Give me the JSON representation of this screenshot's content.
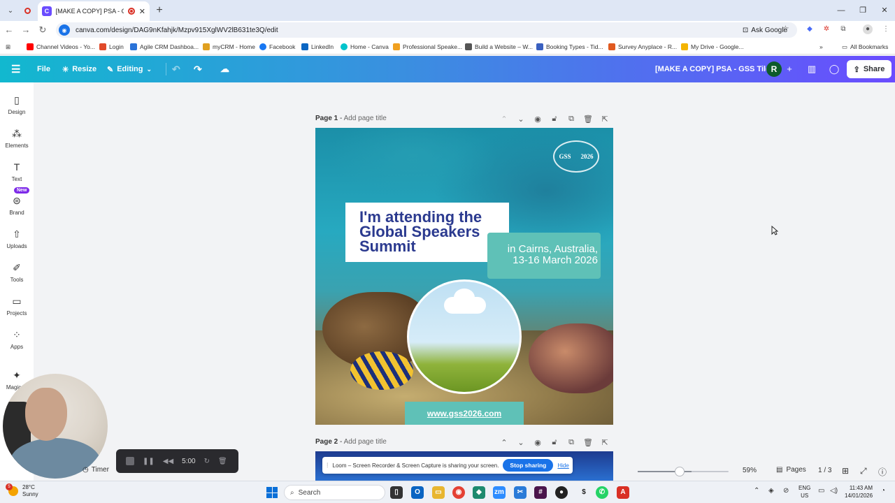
{
  "browser": {
    "tab_title": "[MAKE A COPY] PSA - GSS",
    "new_tab": "+",
    "url": "canva.com/design/DAG9nKfahjk/Mzpv915XglWV2lB631te3Q/edit",
    "ask_google": "Ask Google",
    "bookmarks": [
      "Channel Videos - Yo...",
      "Login",
      "Agile CRM Dashboa...",
      "myCRM - Home",
      "Facebook",
      "LinkedIn",
      "Home - Canva",
      "Professional Speake...",
      "Build a Website – W...",
      "Booking Types - Tid...",
      "Survey Anyplace - R...",
      "My Drive - Google..."
    ],
    "all_bookmarks": "All Bookmarks",
    "bookmark_colors": [
      "#ff0000",
      "#e04a2a",
      "#2a73d8",
      "#e0a020",
      "#1877f2",
      "#0a66c2",
      "#00c4cc",
      "#f0a020",
      "#555555",
      "#3a60c0",
      "#e05a20",
      "#f4b400"
    ]
  },
  "canva_header": {
    "file": "File",
    "resize": "Resize",
    "editing": "Editing",
    "doc_title": "[MAKE A COPY] PSA - GSS Tiles",
    "avatar_initial": "R",
    "share": "Share"
  },
  "sidebar": {
    "items": [
      "Design",
      "Elements",
      "Text",
      "Brand",
      "Uploads",
      "Tools",
      "Projects",
      "Apps",
      "Magic M"
    ],
    "new_badge": "New"
  },
  "pages": [
    {
      "label": "Page 1",
      "title_placeholder": "Add page title"
    },
    {
      "label": "Page 2",
      "title_placeholder": "Add page title"
    }
  ],
  "design": {
    "logo_left": "GSS",
    "logo_right": "2026",
    "headline": [
      "I'm attending the",
      "Global Speakers",
      "Summit"
    ],
    "location": [
      "in Cairns, Australia,",
      "13-16 March 2026"
    ],
    "website": "www.gss2026.com",
    "colors": {
      "headline": "#2b3a8f",
      "teal_box": "#5fc1b7"
    }
  },
  "loom": {
    "message": "Loom – Screen Recorder & Screen Capture is sharing your screen.",
    "stop": "Stop sharing",
    "hide": "Hide"
  },
  "bottom_bar": {
    "zoom": "59%",
    "zoom_level": 0.59,
    "pages": "Pages",
    "page_count": "1 / 3"
  },
  "timer": {
    "label": "Timer",
    "time": "5:00"
  },
  "taskbar": {
    "temperature": "28°C",
    "weather": "Sunny",
    "weather_badge": "5",
    "search": "Search",
    "lang_top": "ENG",
    "lang_bottom": "US",
    "time": "11:43 AM",
    "date": "14/01/2026"
  }
}
